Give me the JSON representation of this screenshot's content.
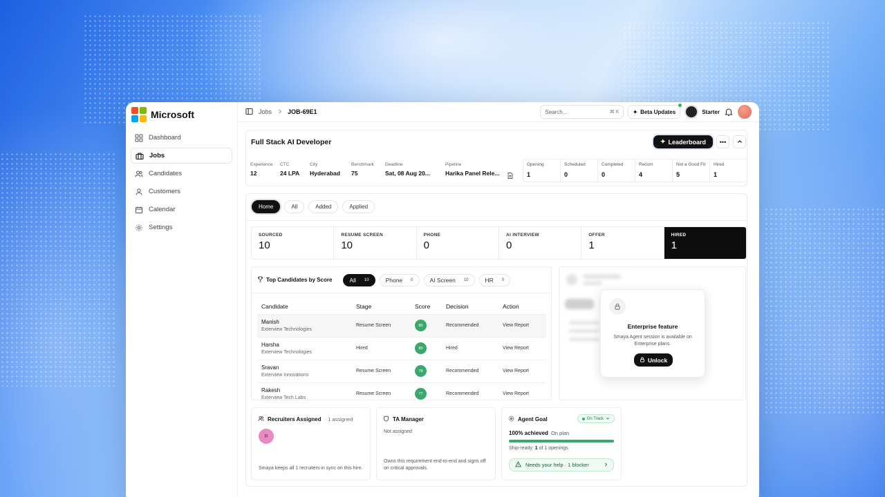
{
  "brand": {
    "name": "Microsoft"
  },
  "sidebar": {
    "items": [
      {
        "label": "Dashboard",
        "icon": "dashboard-icon"
      },
      {
        "label": "Jobs",
        "icon": "briefcase-icon"
      },
      {
        "label": "Candidates",
        "icon": "users-icon"
      },
      {
        "label": "Customers",
        "icon": "user-icon"
      },
      {
        "label": "Calendar",
        "icon": "calendar-icon"
      },
      {
        "label": "Settings",
        "icon": "gear-icon"
      }
    ]
  },
  "topbar": {
    "breadcrumb": [
      "Jobs",
      "JOB-69E1"
    ],
    "search_placeholder": "Search...",
    "search_shortcut": "⌘ K",
    "beta_label": "Beta Updates",
    "plan_label": "Starter"
  },
  "job": {
    "title": "Full Stack AI Developer",
    "leaderboard_label": "Leaderboard",
    "meta": [
      {
        "label": "Experience",
        "value": "12"
      },
      {
        "label": "CTC",
        "value": "24 LPA"
      },
      {
        "label": "City",
        "value": "Hyderabad"
      },
      {
        "label": "Benchmark",
        "value": "75"
      },
      {
        "label": "Deadline",
        "value": "Sat, 08 Aug 20..."
      },
      {
        "label": "Pipeline",
        "value": "Harika Panel Rele..."
      }
    ],
    "stats": [
      {
        "label": "Opening",
        "value": "1"
      },
      {
        "label": "Scheduled",
        "value": "0"
      },
      {
        "label": "Completed",
        "value": "0"
      },
      {
        "label": "Recom",
        "value": "4"
      },
      {
        "label": "Not a Good Fit",
        "value": "5"
      },
      {
        "label": "Hired",
        "value": "1"
      }
    ]
  },
  "filters": {
    "tabs": [
      "Home",
      "All",
      "Added",
      "Applied"
    ],
    "active": "Home"
  },
  "stages": [
    {
      "label": "SOURCED",
      "value": "10"
    },
    {
      "label": "RESUME SCREEN",
      "value": "10"
    },
    {
      "label": "PHONE",
      "value": "0"
    },
    {
      "label": "AI INTERVIEW",
      "value": "0"
    },
    {
      "label": "OFFER",
      "value": "1"
    },
    {
      "label": "HIRED",
      "value": "1"
    }
  ],
  "top_candidates": {
    "title": "Top Candidates by Score",
    "tabs": [
      {
        "label": "All",
        "count": "10"
      },
      {
        "label": "Phone",
        "count": "0"
      },
      {
        "label": "AI Screen",
        "count": "10"
      },
      {
        "label": "HR",
        "count": "0"
      }
    ],
    "columns": [
      "Candidate",
      "Stage",
      "Score",
      "Decision",
      "Action"
    ],
    "rows": [
      {
        "name": "Manish",
        "org": "Exterview Technologies",
        "stage": "Resume Screen",
        "score": "80",
        "decision": "Recommended",
        "action": "View Report"
      },
      {
        "name": "Harsha",
        "org": "Exterview Technologies",
        "stage": "Hired",
        "score": "80",
        "decision": "Hired",
        "action": "View Report"
      },
      {
        "name": "Sravan",
        "org": "Exterview Innovations",
        "stage": "Resume Screen",
        "score": "78",
        "decision": "Recommended",
        "action": "View Report"
      },
      {
        "name": "Rakesh",
        "org": "Exterview Tech Labs",
        "stage": "Resume Screen",
        "score": "77",
        "decision": "Recommended",
        "action": "View Report"
      }
    ]
  },
  "enterprise": {
    "title": "Enterprise feature",
    "description": "Smaya Agent session is available on Enterprise plans.",
    "unlock_label": "Unlock"
  },
  "recruiters": {
    "title": "Recruiters Assigned",
    "count_text": "· 1 assigned",
    "avatar_initial": "R",
    "footer": "Smaya keeps all 1 recruiters in sync on this hire."
  },
  "ta_manager": {
    "title": "TA Manager",
    "status": "Not assigned",
    "footer": "Owns this requirement end-to-end and signs off on critical approvals."
  },
  "agent_goal": {
    "title": "Agent Goal",
    "status": "On Track",
    "achieved": "100% achieved",
    "plan": "On plan",
    "progress": 1.0,
    "ship_prefix": "Ship-ready: ",
    "ship_value": "1",
    "ship_suffix": " of 1 openings",
    "help_text": "Needs your help · 1 blocker"
  },
  "colors": {
    "accent": "#111111",
    "success": "#3aa86a"
  }
}
